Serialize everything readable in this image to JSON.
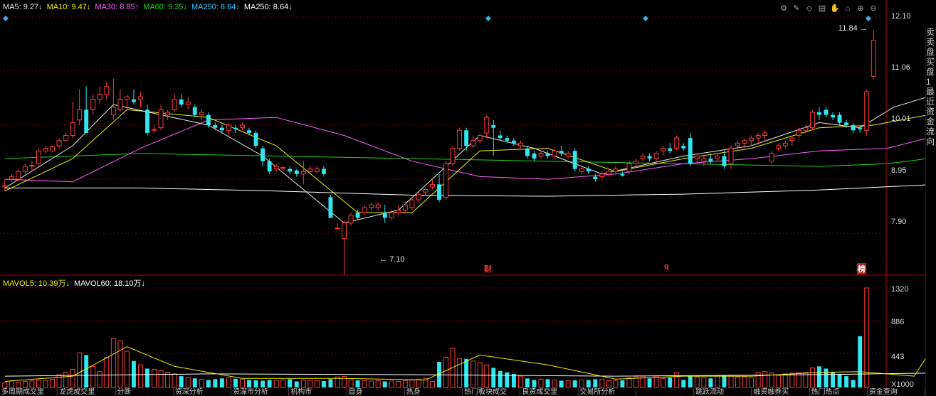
{
  "ma_legend": {
    "ma5": "MA5: 9.27↓",
    "ma10": "MA10: 9.47↓",
    "ma30": "MA30: 8.85↑",
    "ma60": "MA60: 9.35↓",
    "ma250a": "MA250: 8.64↓",
    "ma250b": "MA250: 8.64↓"
  },
  "vol_legend": {
    "mavol5": "MAVOL5: 10.39万↓",
    "mavol60": "MAVOL60: 18.10万↓"
  },
  "colors": {
    "up": "#ff3b3b",
    "down": "#32e6f0",
    "ma5": "#e8e8e8",
    "ma10": "#f0f000",
    "ma30": "#ff60ff",
    "ma60": "#20d020",
    "ma250": "#ffffff",
    "grid": "#7a0000"
  },
  "price_axis": [
    "12.10",
    "11.06",
    "10.01",
    "8.95",
    "7.90"
  ],
  "volume_axis": [
    "1320",
    "886",
    "443"
  ],
  "volume_unit": "X1000",
  "annotations": {
    "high": "11.84",
    "low": "7.10",
    "mark1": "财",
    "mark2": "q",
    "mark3": "榜"
  },
  "toolbar": [
    "gear-icon",
    "pen-icon",
    "eraser-icon",
    "printer-icon",
    "hand-icon",
    "home-icon",
    "zoom-in-icon",
    "zoom-out-icon"
  ],
  "right_panel": [
    "卖",
    "卖",
    "盘",
    "买",
    "盘",
    "1",
    "最",
    "近",
    "资",
    "金",
    "流",
    "向"
  ],
  "bottom_tabs": [
    "多周期成交里",
    "龙虎成交里",
    "分断",
    "资深分析",
    "资深市分析",
    "机构市",
    "自身",
    "热身",
    "热门板块成交",
    "良资成交里",
    "交易所分析",
    "",
    "跳跃流动",
    "融资融券买",
    "热门热点",
    "资金查询"
  ],
  "chart_data": {
    "type": "candlestick",
    "ylim": [
      7.1,
      12.1
    ],
    "candles": [
      [
        8.8,
        8.95,
        8.72,
        8.82
      ],
      [
        8.95,
        9.05,
        8.9,
        9.0
      ],
      [
        8.95,
        9.15,
        8.92,
        9.1
      ],
      [
        9.1,
        9.25,
        9.05,
        9.2
      ],
      [
        9.2,
        9.3,
        9.12,
        9.22
      ],
      [
        9.25,
        9.55,
        9.2,
        9.5
      ],
      [
        9.5,
        9.6,
        9.45,
        9.55
      ],
      [
        9.5,
        9.6,
        9.48,
        9.58
      ],
      [
        9.6,
        9.75,
        9.55,
        9.7
      ],
      [
        9.7,
        9.85,
        9.68,
        9.8
      ],
      [
        9.8,
        10.45,
        9.75,
        10.05
      ],
      [
        10.1,
        10.7,
        10.0,
        10.3
      ],
      [
        10.3,
        10.75,
        9.9,
        9.85
      ],
      [
        10.3,
        10.6,
        10.2,
        10.5
      ],
      [
        10.5,
        10.75,
        10.4,
        10.6
      ],
      [
        10.6,
        10.85,
        10.5,
        10.75
      ],
      [
        10.2,
        10.9,
        10.1,
        10.35
      ],
      [
        10.3,
        10.7,
        10.25,
        10.5
      ],
      [
        10.5,
        10.6,
        10.3,
        10.55
      ],
      [
        10.5,
        10.7,
        10.4,
        10.45
      ],
      [
        10.5,
        10.65,
        10.35,
        10.55
      ],
      [
        10.3,
        10.4,
        9.8,
        9.85
      ],
      [
        9.9,
        10.0,
        9.85,
        9.92
      ],
      [
        9.95,
        10.4,
        9.9,
        10.3
      ],
      [
        10.2,
        10.3,
        10.1,
        10.25
      ],
      [
        10.3,
        10.6,
        10.25,
        10.5
      ],
      [
        10.5,
        10.6,
        10.35,
        10.4
      ],
      [
        10.4,
        10.55,
        10.3,
        10.45
      ],
      [
        10.35,
        10.4,
        10.15,
        10.2
      ],
      [
        10.2,
        10.3,
        10.1,
        10.25
      ],
      [
        10.2,
        10.25,
        9.95,
        10.0
      ],
      [
        10.0,
        10.05,
        9.9,
        9.95
      ],
      [
        9.95,
        10.0,
        9.85,
        9.9
      ],
      [
        9.9,
        10.05,
        9.8,
        10.0
      ],
      [
        9.95,
        10.0,
        9.85,
        9.92
      ],
      [
        9.95,
        10.05,
        9.9,
        10.0
      ],
      [
        9.9,
        9.95,
        9.8,
        9.85
      ],
      [
        9.85,
        9.9,
        9.55,
        9.6
      ],
      [
        9.55,
        9.6,
        9.2,
        9.3
      ],
      [
        9.3,
        9.35,
        9.05,
        9.1
      ],
      [
        9.15,
        9.25,
        9.1,
        9.2
      ],
      [
        9.15,
        9.2,
        9.12,
        9.18
      ],
      [
        9.15,
        9.2,
        9.05,
        9.1
      ],
      [
        9.12,
        9.15,
        9.0,
        9.05
      ],
      [
        9.05,
        9.3,
        8.85,
        9.1
      ],
      [
        9.1,
        9.2,
        9.05,
        9.15
      ],
      [
        9.1,
        9.2,
        9.05,
        9.15
      ],
      [
        9.15,
        9.2,
        9.0,
        9.05
      ],
      [
        8.6,
        8.65,
        8.2,
        8.2
      ],
      [
        8.0,
        8.1,
        7.95,
        8.0
      ],
      [
        7.8,
        8.15,
        7.1,
        8.1
      ],
      [
        8.1,
        8.3,
        8.05,
        8.25
      ],
      [
        8.3,
        8.35,
        8.15,
        8.2
      ],
      [
        8.3,
        8.45,
        8.25,
        8.4
      ],
      [
        8.4,
        8.5,
        8.35,
        8.45
      ],
      [
        8.4,
        8.5,
        8.35,
        8.45
      ],
      [
        8.3,
        8.45,
        8.1,
        8.2
      ],
      [
        8.2,
        8.35,
        8.15,
        8.3
      ],
      [
        8.3,
        8.45,
        8.25,
        8.35
      ],
      [
        8.35,
        8.5,
        8.3,
        8.45
      ],
      [
        8.4,
        8.6,
        8.35,
        8.55
      ],
      [
        8.55,
        8.7,
        8.5,
        8.65
      ],
      [
        8.7,
        8.8,
        8.65,
        8.75
      ],
      [
        8.8,
        8.95,
        8.75,
        8.85
      ],
      [
        8.85,
        9.05,
        8.5,
        8.55
      ],
      [
        8.6,
        9.3,
        8.55,
        9.25
      ],
      [
        9.25,
        9.6,
        9.2,
        9.55
      ],
      [
        9.55,
        9.95,
        9.5,
        9.9
      ],
      [
        9.9,
        9.95,
        9.5,
        9.6
      ],
      [
        9.6,
        9.8,
        9.55,
        9.7
      ],
      [
        9.7,
        9.85,
        9.65,
        9.8
      ],
      [
        9.85,
        10.2,
        9.75,
        10.15
      ],
      [
        10.0,
        10.1,
        9.4,
        9.95
      ],
      [
        9.8,
        9.9,
        9.7,
        9.75
      ],
      [
        9.75,
        9.8,
        9.65,
        9.7
      ],
      [
        9.7,
        9.75,
        9.6,
        9.65
      ],
      [
        9.6,
        9.7,
        9.55,
        9.65
      ],
      [
        9.55,
        9.6,
        9.35,
        9.4
      ],
      [
        9.45,
        9.5,
        9.3,
        9.35
      ],
      [
        9.4,
        9.5,
        9.35,
        9.45
      ],
      [
        9.45,
        9.5,
        9.35,
        9.4
      ],
      [
        9.4,
        9.55,
        9.35,
        9.5
      ],
      [
        9.5,
        9.6,
        9.4,
        9.45
      ],
      [
        9.4,
        9.5,
        9.35,
        9.45
      ],
      [
        9.5,
        9.55,
        9.1,
        9.15
      ],
      [
        9.1,
        9.2,
        9.05,
        9.15
      ],
      [
        9.15,
        9.2,
        9.05,
        9.1
      ],
      [
        9.0,
        9.05,
        8.9,
        8.95
      ],
      [
        9.0,
        9.1,
        8.95,
        9.05
      ],
      [
        9.05,
        9.15,
        9.0,
        9.1
      ],
      [
        9.1,
        9.2,
        9.05,
        9.15
      ],
      [
        9.05,
        9.1,
        9.0,
        9.02
      ],
      [
        9.1,
        9.3,
        9.05,
        9.25
      ],
      [
        9.25,
        9.35,
        9.2,
        9.3
      ],
      [
        9.35,
        9.45,
        9.3,
        9.4
      ],
      [
        9.4,
        9.45,
        9.3,
        9.35
      ],
      [
        9.35,
        9.5,
        9.3,
        9.45
      ],
      [
        9.5,
        9.6,
        9.4,
        9.55
      ],
      [
        9.55,
        9.65,
        9.45,
        9.5
      ],
      [
        9.55,
        9.8,
        9.5,
        9.75
      ],
      [
        9.6,
        9.65,
        9.5,
        9.55
      ],
      [
        9.75,
        9.85,
        9.2,
        9.25
      ],
      [
        9.35,
        9.45,
        9.25,
        9.4
      ],
      [
        9.3,
        9.4,
        9.2,
        9.35
      ],
      [
        9.35,
        9.45,
        9.25,
        9.3
      ],
      [
        9.35,
        9.45,
        9.3,
        9.4
      ],
      [
        9.4,
        9.5,
        9.15,
        9.2
      ],
      [
        9.25,
        9.6,
        9.15,
        9.55
      ],
      [
        9.6,
        9.7,
        9.5,
        9.65
      ],
      [
        9.65,
        9.75,
        9.55,
        9.7
      ],
      [
        9.7,
        9.8,
        9.6,
        9.75
      ],
      [
        9.75,
        9.85,
        9.65,
        9.8
      ],
      [
        9.8,
        9.9,
        9.7,
        9.85
      ],
      [
        9.3,
        9.5,
        9.25,
        9.45
      ],
      [
        9.55,
        9.65,
        9.5,
        9.6
      ],
      [
        9.6,
        9.7,
        9.55,
        9.65
      ],
      [
        9.7,
        9.8,
        9.6,
        9.75
      ],
      [
        9.8,
        9.95,
        9.75,
        9.9
      ],
      [
        9.9,
        10.0,
        9.85,
        9.95
      ],
      [
        9.95,
        10.3,
        9.9,
        10.25
      ],
      [
        10.25,
        10.35,
        10.1,
        10.2
      ],
      [
        10.3,
        10.35,
        10.15,
        10.2
      ],
      [
        10.2,
        10.25,
        10.1,
        10.15
      ],
      [
        10.2,
        10.25,
        10.0,
        10.05
      ],
      [
        10.05,
        10.1,
        9.95,
        10.0
      ],
      [
        10.0,
        10.05,
        9.85,
        9.9
      ],
      [
        9.95,
        10.0,
        9.85,
        9.92
      ],
      [
        9.9,
        10.7,
        9.8,
        10.65
      ],
      [
        10.95,
        11.84,
        10.9,
        11.65
      ]
    ],
    "ma5": [
      [
        0,
        8.78
      ],
      [
        10,
        9.6
      ],
      [
        16,
        10.4
      ],
      [
        30,
        10.0
      ],
      [
        38,
        9.4
      ],
      [
        50,
        8.1
      ],
      [
        58,
        8.35
      ],
      [
        70,
        9.8
      ],
      [
        78,
        9.55
      ],
      [
        88,
        9.05
      ],
      [
        100,
        9.4
      ],
      [
        110,
        9.6
      ],
      [
        120,
        10.05
      ],
      [
        126,
        9.95
      ],
      [
        131,
        10.35
      ],
      [
        136,
        10.55
      ]
    ],
    "ma10": [
      [
        0,
        8.72
      ],
      [
        10,
        9.35
      ],
      [
        18,
        10.3
      ],
      [
        30,
        10.15
      ],
      [
        40,
        9.6
      ],
      [
        52,
        8.3
      ],
      [
        60,
        8.3
      ],
      [
        70,
        9.5
      ],
      [
        80,
        9.55
      ],
      [
        90,
        9.1
      ],
      [
        100,
        9.35
      ],
      [
        110,
        9.55
      ],
      [
        120,
        9.95
      ],
      [
        128,
        10.0
      ],
      [
        136,
        10.2
      ]
    ],
    "ma30": [
      [
        0,
        8.95
      ],
      [
        10,
        8.9
      ],
      [
        20,
        9.55
      ],
      [
        30,
        10.1
      ],
      [
        40,
        10.15
      ],
      [
        50,
        9.8
      ],
      [
        60,
        9.3
      ],
      [
        70,
        9.0
      ],
      [
        80,
        8.95
      ],
      [
        90,
        9.05
      ],
      [
        100,
        9.25
      ],
      [
        110,
        9.35
      ],
      [
        120,
        9.5
      ],
      [
        130,
        9.55
      ],
      [
        136,
        9.75
      ]
    ],
    "ma60": [
      [
        0,
        9.35
      ],
      [
        20,
        9.45
      ],
      [
        40,
        9.4
      ],
      [
        60,
        9.35
      ],
      [
        80,
        9.3
      ],
      [
        100,
        9.25
      ],
      [
        120,
        9.2
      ],
      [
        130,
        9.25
      ],
      [
        136,
        9.35
      ]
    ],
    "ma250": [
      [
        0,
        8.78
      ],
      [
        20,
        8.78
      ],
      [
        40,
        8.72
      ],
      [
        60,
        8.64
      ],
      [
        80,
        8.62
      ],
      [
        100,
        8.66
      ],
      [
        120,
        8.74
      ],
      [
        136,
        8.84
      ]
    ],
    "volume_ylim": [
      0,
      1320
    ],
    "volume": [
      60,
      90,
      70,
      80,
      85,
      95,
      95,
      110,
      170,
      200,
      240,
      460,
      430,
      280,
      210,
      400,
      650,
      620,
      480,
      350,
      300,
      250,
      240,
      220,
      200,
      180,
      150,
      130,
      120,
      110,
      100,
      110,
      120,
      130,
      115,
      110,
      100,
      95,
      90,
      100,
      95,
      100,
      110,
      80,
      100,
      95,
      90,
      85,
      110,
      140,
      145,
      100,
      95,
      90,
      85,
      90,
      80,
      85,
      80,
      90,
      100,
      110,
      120,
      80,
      340,
      400,
      520,
      380,
      380,
      350,
      330,
      300,
      260,
      220,
      200,
      180,
      150,
      120,
      100,
      110,
      110,
      100,
      90,
      90,
      95,
      100,
      100,
      110,
      110,
      90,
      90,
      95,
      130,
      140,
      150,
      120,
      150,
      120,
      130,
      200,
      100,
      150,
      140,
      130,
      120,
      150,
      160,
      150,
      140,
      140,
      130,
      200,
      210,
      190,
      160,
      180,
      190,
      200,
      200,
      260,
      280,
      250,
      200,
      180,
      150,
      100,
      680,
      1320
    ],
    "mavol5": [
      [
        0,
        80
      ],
      [
        10,
        150
      ],
      [
        18,
        540
      ],
      [
        25,
        280
      ],
      [
        35,
        120
      ],
      [
        50,
        120
      ],
      [
        62,
        100
      ],
      [
        70,
        430
      ],
      [
        80,
        300
      ],
      [
        90,
        110
      ],
      [
        100,
        150
      ],
      [
        110,
        150
      ],
      [
        120,
        200
      ],
      [
        126,
        210
      ],
      [
        134,
        150
      ],
      [
        136,
        430
      ]
    ],
    "mavol60": [
      [
        0,
        150
      ],
      [
        30,
        180
      ],
      [
        60,
        170
      ],
      [
        90,
        150
      ],
      [
        120,
        170
      ],
      [
        136,
        190
      ]
    ]
  }
}
